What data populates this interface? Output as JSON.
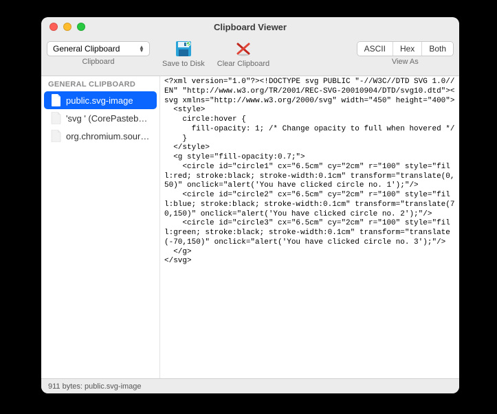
{
  "window": {
    "title": "Clipboard Viewer"
  },
  "toolbar": {
    "clipboard_selector": {
      "selected": "General Clipboard",
      "label": "Clipboard"
    },
    "save_label": "Save to Disk",
    "clear_label": "Clear Clipboard",
    "view_as": {
      "label": "View As",
      "options": [
        "ASCII",
        "Hex",
        "Both"
      ]
    }
  },
  "sidebar": {
    "section": "GENERAL CLIPBOARD",
    "items": [
      {
        "label": "public.svg-image",
        "selected": true
      },
      {
        "label": "'svg ' (CorePastebo…",
        "selected": false
      },
      {
        "label": "org.chromium.sourc…",
        "selected": false
      }
    ]
  },
  "content_text": "<?xml version=\"1.0\"?><!DOCTYPE svg PUBLIC \"-//W3C//DTD SVG 1.0//EN\" \"http://www.w3.org/TR/2001/REC-SVG-20010904/DTD/svg10.dtd\"><svg xmlns=\"http://www.w3.org/2000/svg\" width=\"450\" height=\"400\">\n  <style>\n    circle:hover {\n      fill-opacity: 1; /* Change opacity to full when hovered */\n    }\n  </style>\n  <g style=\"fill-opacity:0.7;\">\n    <circle id=\"circle1\" cx=\"6.5cm\" cy=\"2cm\" r=\"100\" style=\"fill:red; stroke:black; stroke-width:0.1cm\" transform=\"translate(0,50)\" onclick=\"alert('You have clicked circle no. 1');\"/>\n    <circle id=\"circle2\" cx=\"6.5cm\" cy=\"2cm\" r=\"100\" style=\"fill:blue; stroke:black; stroke-width:0.1cm\" transform=\"translate(70,150)\" onclick=\"alert('You have clicked circle no. 2');\"/>\n    <circle id=\"circle3\" cx=\"6.5cm\" cy=\"2cm\" r=\"100\" style=\"fill:green; stroke:black; stroke-width:0.1cm\" transform=\"translate(-70,150)\" onclick=\"alert('You have clicked circle no. 3');\"/>\n  </g>\n</svg>",
  "status": "911 bytes: public.svg-image"
}
